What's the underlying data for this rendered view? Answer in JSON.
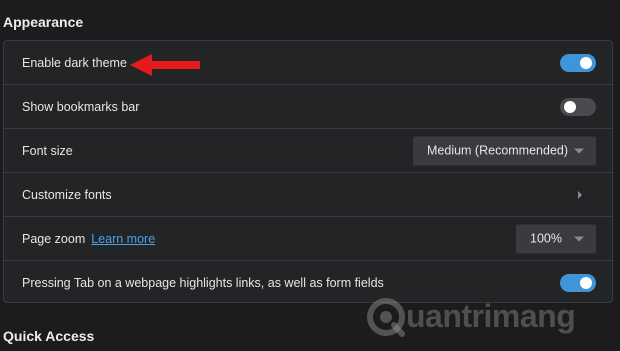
{
  "sections": {
    "appearance_title": "Appearance",
    "quick_access_title": "Quick Access"
  },
  "settings": {
    "dark_theme_label": "Enable dark theme",
    "dark_theme_on": true,
    "bookmarks_bar_label": "Show bookmarks bar",
    "bookmarks_bar_on": false,
    "font_size_label": "Font size",
    "font_size_value": "Medium (Recommended)",
    "customize_fonts_label": "Customize fonts",
    "page_zoom_label": "Page zoom",
    "page_zoom_link": "Learn more",
    "page_zoom_value": "100%",
    "tab_highlight_label": "Pressing Tab on a webpage highlights links, as well as form fields",
    "tab_highlight_on": true
  },
  "colors": {
    "toggle_on": "#3f95d8",
    "toggle_off": "#4a4b4f",
    "link": "#4aa2ea",
    "annotation_arrow": "#e51b1b"
  },
  "icons": {
    "annotation": "red-arrow-left-icon",
    "dropdown": "caret-down-icon",
    "submenu": "chevron-right-icon",
    "watermark_logo": "quantrimang-logo-icon"
  },
  "watermark": {
    "text": "uantrimang"
  }
}
